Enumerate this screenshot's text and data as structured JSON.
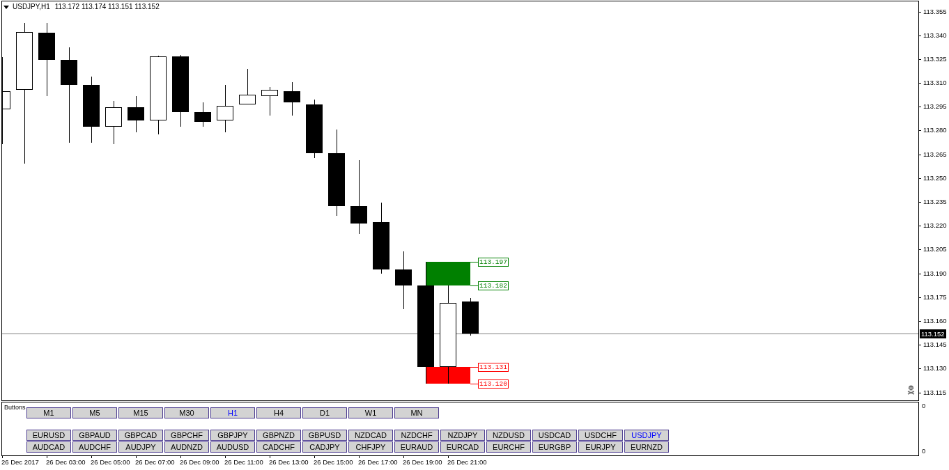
{
  "chart": {
    "header": {
      "symbol": "USDJPY,H1",
      "quote": "113.172 113.174 113.151 113.152"
    },
    "zones": [
      {
        "color": "#008000",
        "labels": [
          "113.197",
          "113.182"
        ]
      },
      {
        "color": "#ff0000",
        "labels": [
          "113.131",
          "113.120"
        ]
      }
    ],
    "price_axis": {
      "ticks": [
        "113.355",
        "113.340",
        "113.325",
        "113.310",
        "113.295",
        "113.280",
        "113.265",
        "113.250",
        "113.235",
        "113.220",
        "113.205",
        "113.190",
        "113.175",
        "113.160",
        "113.145",
        "113.130",
        "113.115"
      ],
      "current_price": "113.152"
    },
    "time_axis": {
      "labels": [
        "26 Dec 2017",
        "26 Dec 03:00",
        "26 Dec 05:00",
        "26 Dec 07:00",
        "26 Dec 09:00",
        "26 Dec 11:00",
        "26 Dec 13:00",
        "26 Dec 15:00",
        "26 Dec 17:00",
        "26 Dec 19:00",
        "26 Dec 21:00"
      ]
    }
  },
  "indicator_panel": {
    "title": "Buttons",
    "axis_labels": [
      "0",
      "0"
    ],
    "timeframes": [
      {
        "label": "M1",
        "selected": false
      },
      {
        "label": "M5",
        "selected": false
      },
      {
        "label": "M15",
        "selected": false
      },
      {
        "label": "M30",
        "selected": false
      },
      {
        "label": "H1",
        "selected": true
      },
      {
        "label": "H4",
        "selected": false
      },
      {
        "label": "D1",
        "selected": false
      },
      {
        "label": "W1",
        "selected": false
      },
      {
        "label": "MN",
        "selected": false
      }
    ],
    "symbol_rows": [
      [
        {
          "label": "EURUSD",
          "selected": false
        },
        {
          "label": "GBPAUD",
          "selected": false
        },
        {
          "label": "GBPCAD",
          "selected": false
        },
        {
          "label": "GBPCHF",
          "selected": false
        },
        {
          "label": "GBPJPY",
          "selected": false
        },
        {
          "label": "GBPNZD",
          "selected": false
        },
        {
          "label": "GBPUSD",
          "selected": false
        },
        {
          "label": "NZDCAD",
          "selected": false
        },
        {
          "label": "NZDCHF",
          "selected": false
        },
        {
          "label": "NZDJPY",
          "selected": false
        },
        {
          "label": "NZDUSD",
          "selected": false
        },
        {
          "label": "USDCAD",
          "selected": false
        },
        {
          "label": "USDCHF",
          "selected": false
        },
        {
          "label": "USDJPY",
          "selected": true
        }
      ],
      [
        {
          "label": "AUDCAD",
          "selected": false
        },
        {
          "label": "AUDCHF",
          "selected": false
        },
        {
          "label": "AUDJPY",
          "selected": false
        },
        {
          "label": "AUDNZD",
          "selected": false
        },
        {
          "label": "AUDUSD",
          "selected": false
        },
        {
          "label": "CADCHF",
          "selected": false
        },
        {
          "label": "CADJPY",
          "selected": false
        },
        {
          "label": "CHFJPY",
          "selected": false
        },
        {
          "label": "EURAUD",
          "selected": false
        },
        {
          "label": "EURCAD",
          "selected": false
        },
        {
          "label": "EURCHF",
          "selected": false
        },
        {
          "label": "EURGBP",
          "selected": false
        },
        {
          "label": "EURJPY",
          "selected": false
        },
        {
          "label": "EURNZD",
          "selected": false
        }
      ]
    ]
  }
}
